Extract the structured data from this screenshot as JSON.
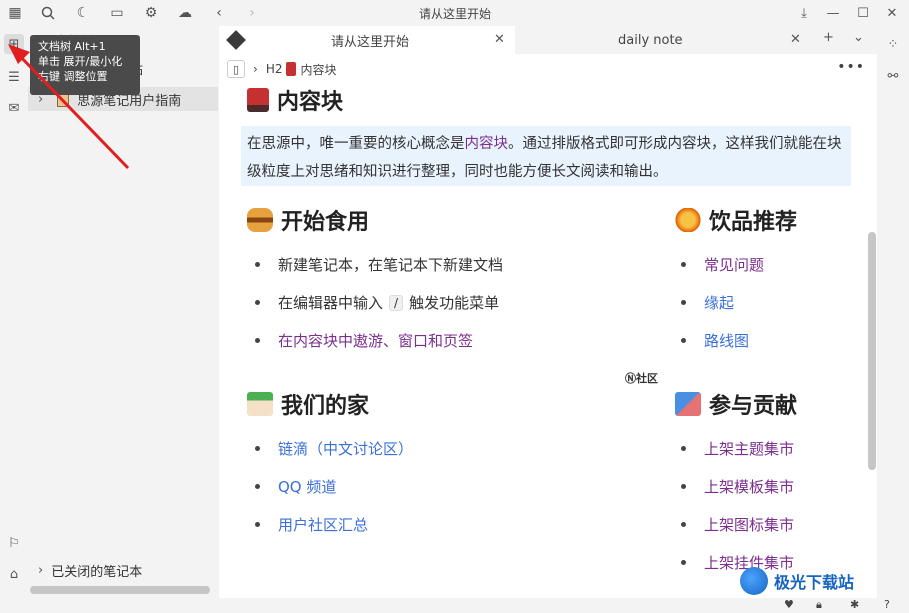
{
  "window": {
    "title": "请从这里开始"
  },
  "tooltip": {
    "line1": "文档树 Alt+1",
    "line2": "单击 展开/最小化",
    "line3": "右键 调整位置"
  },
  "tree": {
    "header": "文档树",
    "rows": [
      {
        "label": "站"
      },
      {
        "label": "思源笔记用户指南"
      }
    ],
    "closed_notebooks": "已关闭的笔记本"
  },
  "tabs": [
    {
      "label": "请从这里开始",
      "active": true
    },
    {
      "label": "daily note",
      "active": false
    }
  ],
  "breadcrumb": {
    "heading_tag": "H2",
    "label": "内容块"
  },
  "doc": {
    "title": "内容块",
    "callout_part1": "在思源中，唯一重要的核心概念是",
    "callout_link": "内容块",
    "callout_part2": "。通过排版格式即可形成内容块，这样我们就能在块级粒度上对思绪和知识进行整理，同时也能方便长文阅读和输出。",
    "sections": {
      "start": {
        "title": "开始食用",
        "items": [
          "新建笔记本，在笔记本下新建文档",
          "在编辑器中输入",
          "触发功能菜单",
          "在内容块中遨游、窗口和页签"
        ],
        "kbd": "/"
      },
      "drinks": {
        "title": "饮品推荐",
        "items": [
          "常见问题",
          "缘起",
          "路线图"
        ]
      },
      "home": {
        "title": "我们的家",
        "items": [
          "链滴（中文讨论区）",
          "QQ 频道",
          "用户社区汇总"
        ]
      },
      "contribute": {
        "title": "参与贡献",
        "items": [
          "上架主题集市",
          "上架模板集市",
          "上架图标集市",
          "上架挂件集市"
        ]
      },
      "community_badge": "社区"
    }
  },
  "watermark": "极光下载站"
}
